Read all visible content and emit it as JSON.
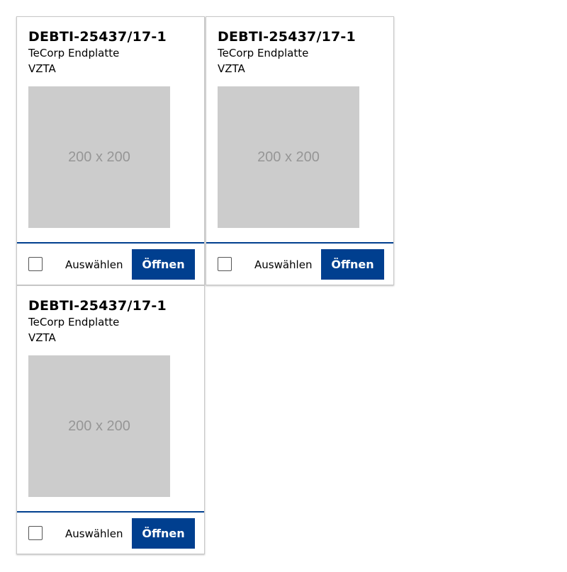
{
  "cards": [
    {
      "title": "DEBTI-25437/17-1",
      "subtitle": "TeCorp Endplatte",
      "material": "VZTA",
      "image_placeholder": "200 x 200",
      "select_label": "Auswählen",
      "open_label": "Öffnen"
    },
    {
      "title": "DEBTI-25437/17-1",
      "subtitle": "TeCorp Endplatte",
      "material": "VZTA",
      "image_placeholder": "200 x 200",
      "select_label": "Auswählen",
      "open_label": "Öffnen"
    },
    {
      "title": "DEBTI-25437/17-1",
      "subtitle": "TeCorp Endplatte",
      "material": "VZTA",
      "image_placeholder": "200 x 200",
      "select_label": "Auswählen",
      "open_label": "Öffnen"
    }
  ],
  "colors": {
    "accent": "#003f8f",
    "placeholder_bg": "#cccccc",
    "placeholder_text": "#969696"
  }
}
